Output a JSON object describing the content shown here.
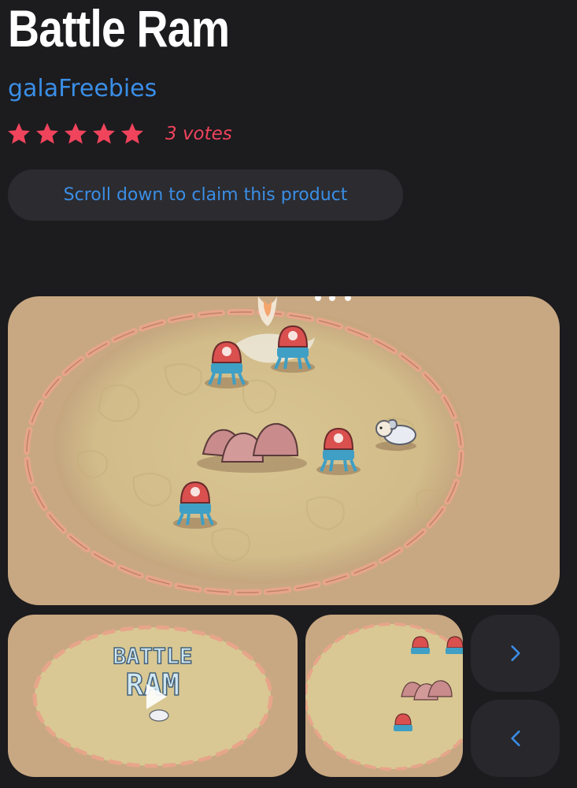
{
  "product": {
    "title": "Battle Ram",
    "author": "galaFreebies",
    "rating": {
      "stars": 5,
      "votes_label": "3 votes"
    },
    "claim_label": "Scroll down to claim this product"
  },
  "gallery": {
    "thumb1_logo_line1": "BATTLE",
    "thumb1_logo_line2": "RAM",
    "next_icon": "chevron-right-icon",
    "prev_icon": "chevron-left-icon"
  },
  "colors": {
    "background": "#1c1b1e",
    "link": "#3a8ee6",
    "star": "#f0445c",
    "button": "#2c2b2f",
    "arena_sand": "#c8a882",
    "arena_field": "#d8c690",
    "enemy_red": "#d9504f",
    "enemy_legs": "#4fb6d4"
  }
}
